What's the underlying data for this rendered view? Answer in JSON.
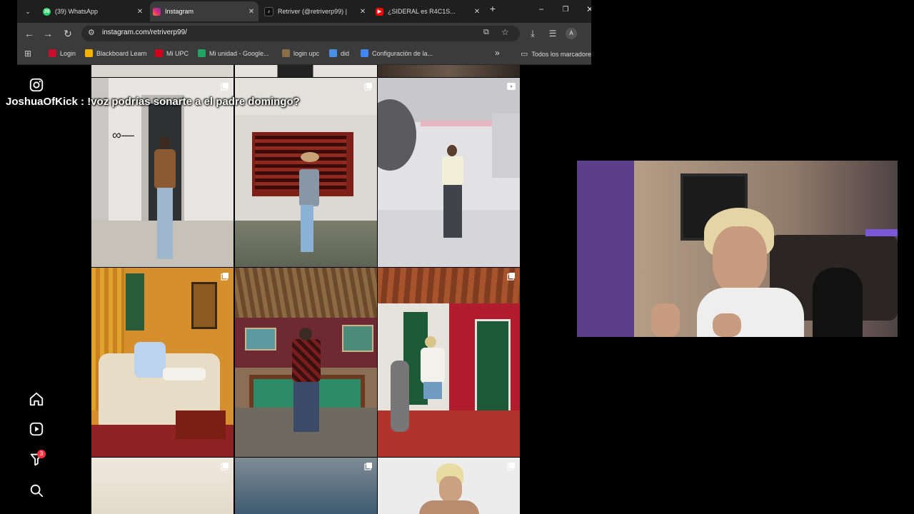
{
  "tabs": [
    {
      "title": "(39) WhatsApp",
      "badge": "39",
      "color": "#25d366",
      "active": false
    },
    {
      "title": "Instagram",
      "color": "#e1306c",
      "active": true
    },
    {
      "title": "Retriver (@retriverp99) |",
      "color": "#111111",
      "active": false
    },
    {
      "title": "¿SIDERAL es R4C1S...",
      "color": "#ff0000",
      "active": false
    }
  ],
  "new_tab_label": "+",
  "window_controls": {
    "minimize": "−",
    "maximize": "❐",
    "close": "✕"
  },
  "toolbar": {
    "url": "instagram.com/retriverp99/",
    "profile_initial": "A"
  },
  "bookmarks": [
    {
      "label": "Login",
      "color": "#c8102e"
    },
    {
      "label": "Blackboard Learn",
      "color": "#f4b400"
    },
    {
      "label": "Mi UPC",
      "color": "#d0021b"
    },
    {
      "label": "Mi unidad - Google...",
      "color": "#1fa463"
    },
    {
      "label": "login upc",
      "color": "#8a6d4b"
    },
    {
      "label": "did",
      "color": "#4a90e2"
    },
    {
      "label": "Configuración de la...",
      "color": "#4285f4"
    }
  ],
  "bookmarks_more": "»",
  "all_bookmarks": "Todos los marcadores",
  "instagram": {
    "sidebar": [
      {
        "name": "instagram-logo-icon"
      },
      {
        "name": "home-icon"
      },
      {
        "name": "reels-icon"
      },
      {
        "name": "notifications-icon",
        "badge": "3"
      },
      {
        "name": "search-icon"
      }
    ],
    "posts_count_visible": 12
  },
  "chat_overlay": {
    "user": "JoshuaOfKick",
    "separator": " : ",
    "message": "!voz podrías sonarte a el padre domingo?"
  },
  "colors": {
    "tabbar": "#1f1f1f",
    "toolbar": "#3b3b3b",
    "badge": "#ff3040"
  }
}
